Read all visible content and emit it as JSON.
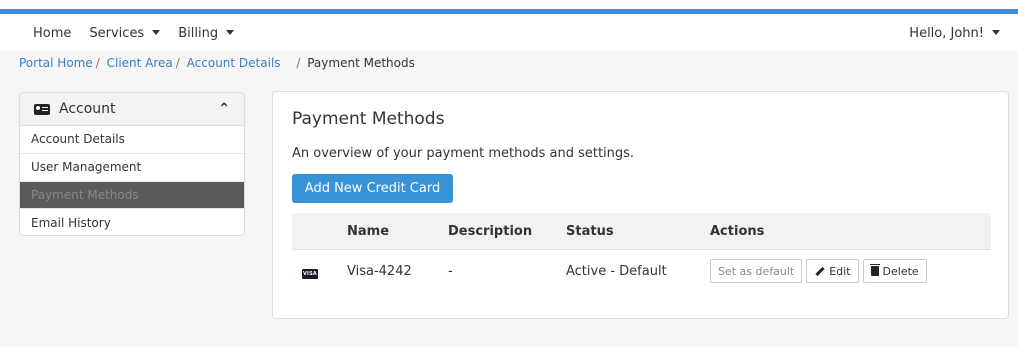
{
  "nav": {
    "home": "Home",
    "services": "Services",
    "billing": "Billing",
    "greeting": "Hello, John!"
  },
  "breadcrumb": {
    "items": [
      "Portal Home",
      "Client Area",
      "Account Details"
    ],
    "current": "Payment Methods"
  },
  "sidebar": {
    "title": "Account",
    "items": [
      {
        "label": "Account Details"
      },
      {
        "label": "User Management"
      },
      {
        "label": "Payment Methods"
      },
      {
        "label": "Email History"
      }
    ],
    "active_index": 2
  },
  "main": {
    "title": "Payment Methods",
    "description": "An overview of your payment methods and settings.",
    "add_button": "Add New Credit Card",
    "table": {
      "headers": [
        "Name",
        "Description",
        "Status",
        "Actions"
      ],
      "rows": [
        {
          "card_brand_icon": "VISA",
          "name": "Visa-4242",
          "description": "-",
          "status": "Active - Default",
          "actions": {
            "set_default": "Set as default",
            "edit": "Edit",
            "delete": "Delete"
          }
        }
      ]
    }
  },
  "colors": {
    "accent": "#3b8ed8",
    "button": "#3792d6",
    "link": "#3a7ec3",
    "active_sidebar": "#5a5a5a"
  }
}
